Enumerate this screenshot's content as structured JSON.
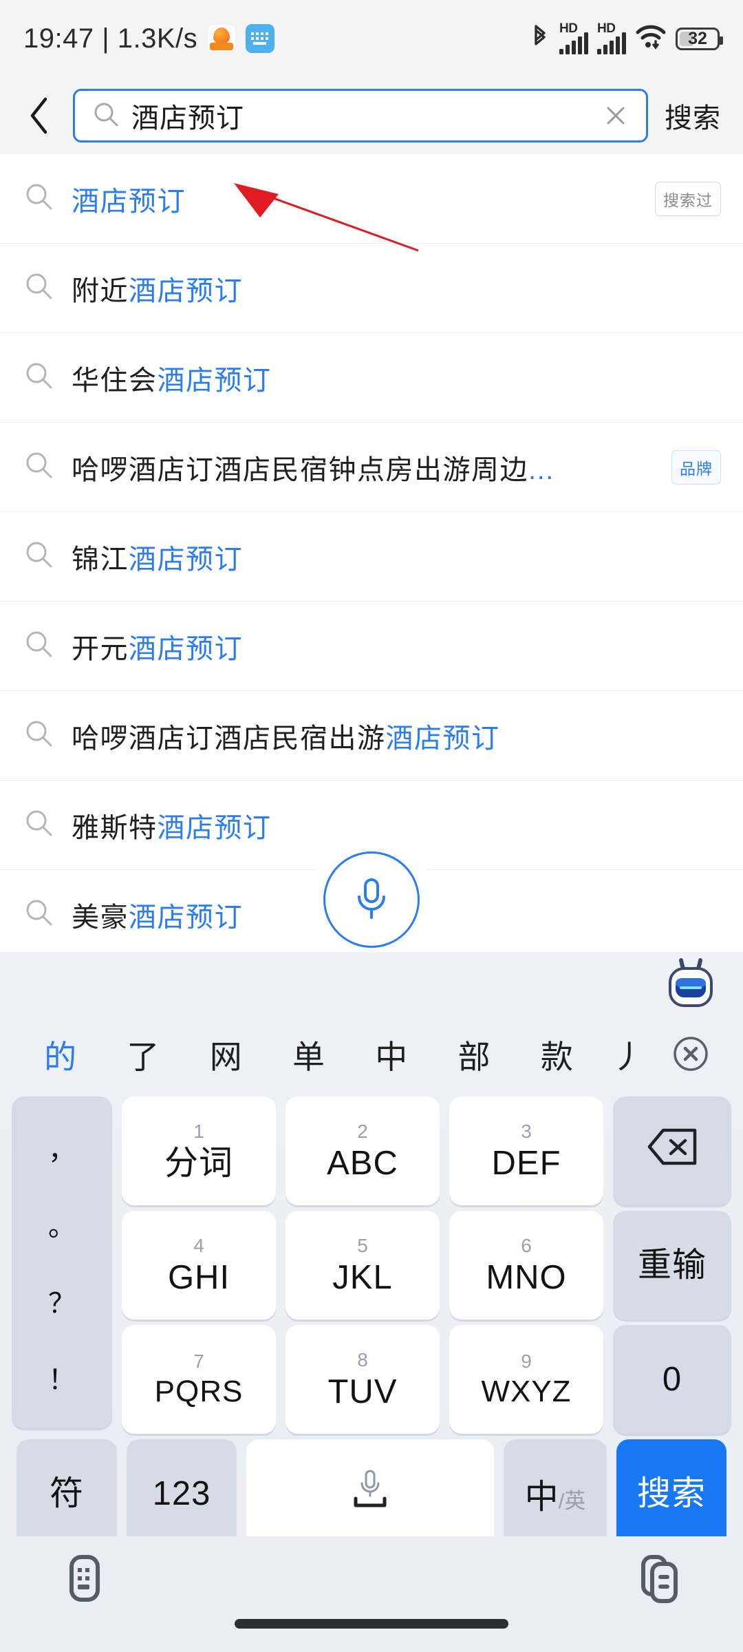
{
  "status_bar": {
    "time": "19:47",
    "separator": "|",
    "network_speed": "1.3K/s",
    "app_icons": [
      {
        "name": "orange-app-icon"
      },
      {
        "name": "keyboard-notification-icon"
      }
    ],
    "bluetooth_icon": "bluetooth-icon",
    "signal_labels": [
      "HD",
      "HD"
    ],
    "wifi_icon": "wifi-icon",
    "battery_level": "32"
  },
  "header": {
    "back_icon": "back-chevron-icon",
    "search_icon": "search-icon",
    "query_value": "酒店预订",
    "query_placeholder": "搜索",
    "clear_icon": "clear-x-icon",
    "search_button": "搜索"
  },
  "suggestions": [
    {
      "prefix": "",
      "highlight": "酒店预订",
      "suffix": "",
      "ellipsis": "",
      "badge": "搜索过",
      "badge_type": "gray"
    },
    {
      "prefix": "附近",
      "highlight": "酒店预订",
      "suffix": "",
      "ellipsis": "",
      "badge": "",
      "badge_type": ""
    },
    {
      "prefix": "华住会",
      "highlight": "酒店预订",
      "suffix": "",
      "ellipsis": "",
      "badge": "",
      "badge_type": ""
    },
    {
      "prefix": "哈啰酒店订酒店民宿钟点房出游周边",
      "highlight": "",
      "suffix": "",
      "ellipsis": "...",
      "badge": "品牌",
      "badge_type": "blue"
    },
    {
      "prefix": "锦江",
      "highlight": "酒店预订",
      "suffix": "",
      "ellipsis": "",
      "badge": "",
      "badge_type": ""
    },
    {
      "prefix": "开元",
      "highlight": "酒店预订",
      "suffix": "",
      "ellipsis": "",
      "badge": "",
      "badge_type": ""
    },
    {
      "prefix": "哈啰酒店订酒店民宿出游",
      "highlight": "酒店预订",
      "suffix": "",
      "ellipsis": "",
      "badge": "",
      "badge_type": ""
    },
    {
      "prefix": "雅斯特",
      "highlight": "酒店预订",
      "suffix": "",
      "ellipsis": "",
      "badge": "",
      "badge_type": ""
    },
    {
      "prefix": "美豪",
      "highlight": "酒店预订",
      "suffix": "",
      "ellipsis": "",
      "badge": "",
      "badge_type": ""
    }
  ],
  "voice_button": {
    "icon": "microphone-icon"
  },
  "annotation": {
    "type": "red-arrow",
    "color": "#e01b22"
  },
  "keyboard": {
    "assistant_icon": "robot-assistant-icon",
    "candidates": [
      "的",
      "了",
      "网",
      "单",
      "中",
      "部",
      "款"
    ],
    "active_candidate": "的",
    "stroke_candidate": "丿",
    "close_candidates_icon": "close-circle-icon",
    "punctuation": [
      "，",
      "。",
      "？",
      "！"
    ],
    "rows": [
      {
        "keys": [
          {
            "num": "1",
            "label": "分词",
            "style": "white",
            "name": "key-1-fenci"
          },
          {
            "num": "2",
            "label": "ABC",
            "style": "white",
            "name": "key-2-abc"
          },
          {
            "num": "3",
            "label": "DEF",
            "style": "white",
            "name": "key-3-def"
          },
          {
            "num": "",
            "label": "",
            "style": "grey",
            "name": "backspace-key",
            "icon": "backspace-icon"
          }
        ]
      },
      {
        "keys": [
          {
            "num": "4",
            "label": "GHI",
            "style": "white",
            "name": "key-4-ghi"
          },
          {
            "num": "5",
            "label": "JKL",
            "style": "white",
            "name": "key-5-jkl"
          },
          {
            "num": "6",
            "label": "MNO",
            "style": "white",
            "name": "key-6-mno"
          },
          {
            "num": "",
            "label": "重输",
            "style": "grey",
            "name": "retype-key"
          }
        ]
      },
      {
        "keys": [
          {
            "num": "7",
            "label": "PQRS",
            "style": "white",
            "name": "key-7-pqrs"
          },
          {
            "num": "8",
            "label": "TUV",
            "style": "white",
            "name": "key-8-tuv"
          },
          {
            "num": "9",
            "label": "WXYZ",
            "style": "white",
            "name": "key-9-wxyz"
          },
          {
            "num": "",
            "label": "0",
            "style": "grey",
            "name": "key-0"
          }
        ]
      }
    ],
    "bottom_row": {
      "symbol_key": "符",
      "numeric_key": "123",
      "space_key_icon": "microphone-space-icon",
      "lang_zh": "中",
      "lang_sep": "/",
      "lang_en": "英",
      "enter_key": "搜索"
    }
  },
  "nav_bar": {
    "keyboard_switch_icon": "keyboard-switch-icon",
    "clipboard_icon": "clipboard-icon",
    "home_indicator": "home-indicator"
  },
  "colors": {
    "accent_blue": "#2b7cf0",
    "enter_blue": "#1877f2",
    "annotation_red": "#e01b22",
    "page_bg": "#ffffff",
    "chrome_bg": "#f4f4f5",
    "keyboard_bg": "#eef1f6"
  }
}
